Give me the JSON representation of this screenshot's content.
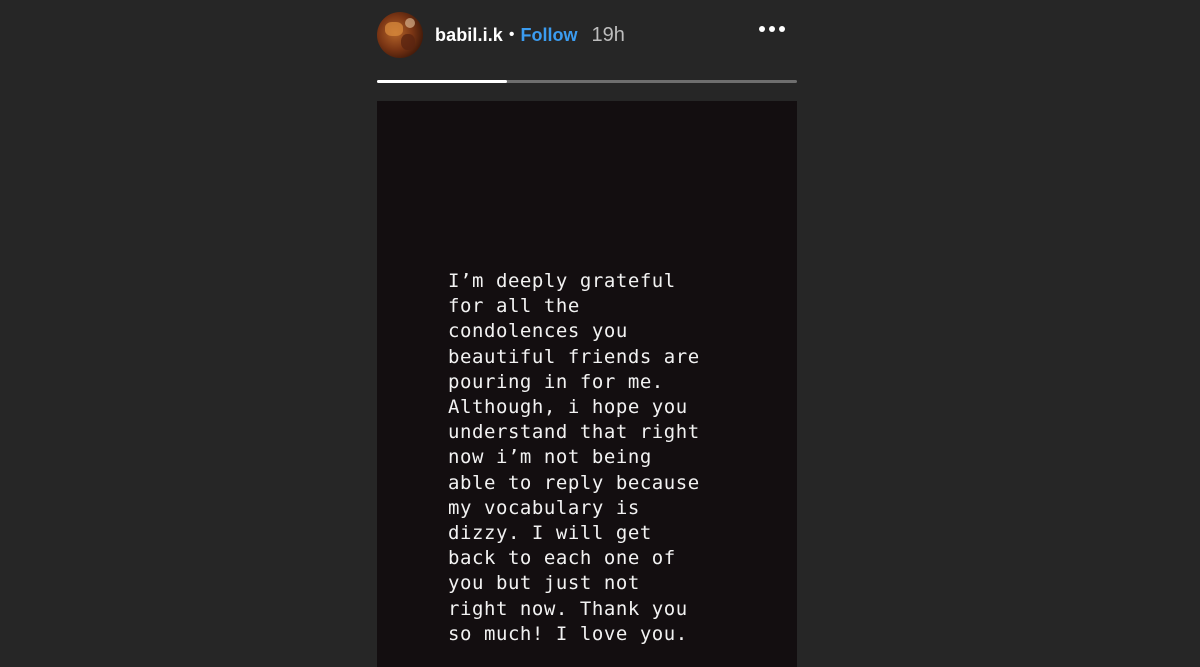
{
  "header": {
    "username": "babil.i.k",
    "separator": "•",
    "follow_label": "Follow",
    "timestamp": "19h",
    "avatar_icon": "profile-avatar",
    "more_icon": "more-horizontal-icon"
  },
  "progress": {
    "segment_fraction": 0.31
  },
  "story": {
    "text": "I’m deeply grateful\nfor all the\ncondolences you\nbeautiful friends are\npouring in for me.\nAlthough, i hope you\nunderstand that right\nnow i’m not being\nable to reply because\nmy vocabulary is\ndizzy. I will get\nback to each one of\nyou but just not\nright now. Thank you\nso much! I love you."
  },
  "colors": {
    "background": "#262626",
    "follow": "#3b9cf0",
    "story_background": "#130e10"
  }
}
